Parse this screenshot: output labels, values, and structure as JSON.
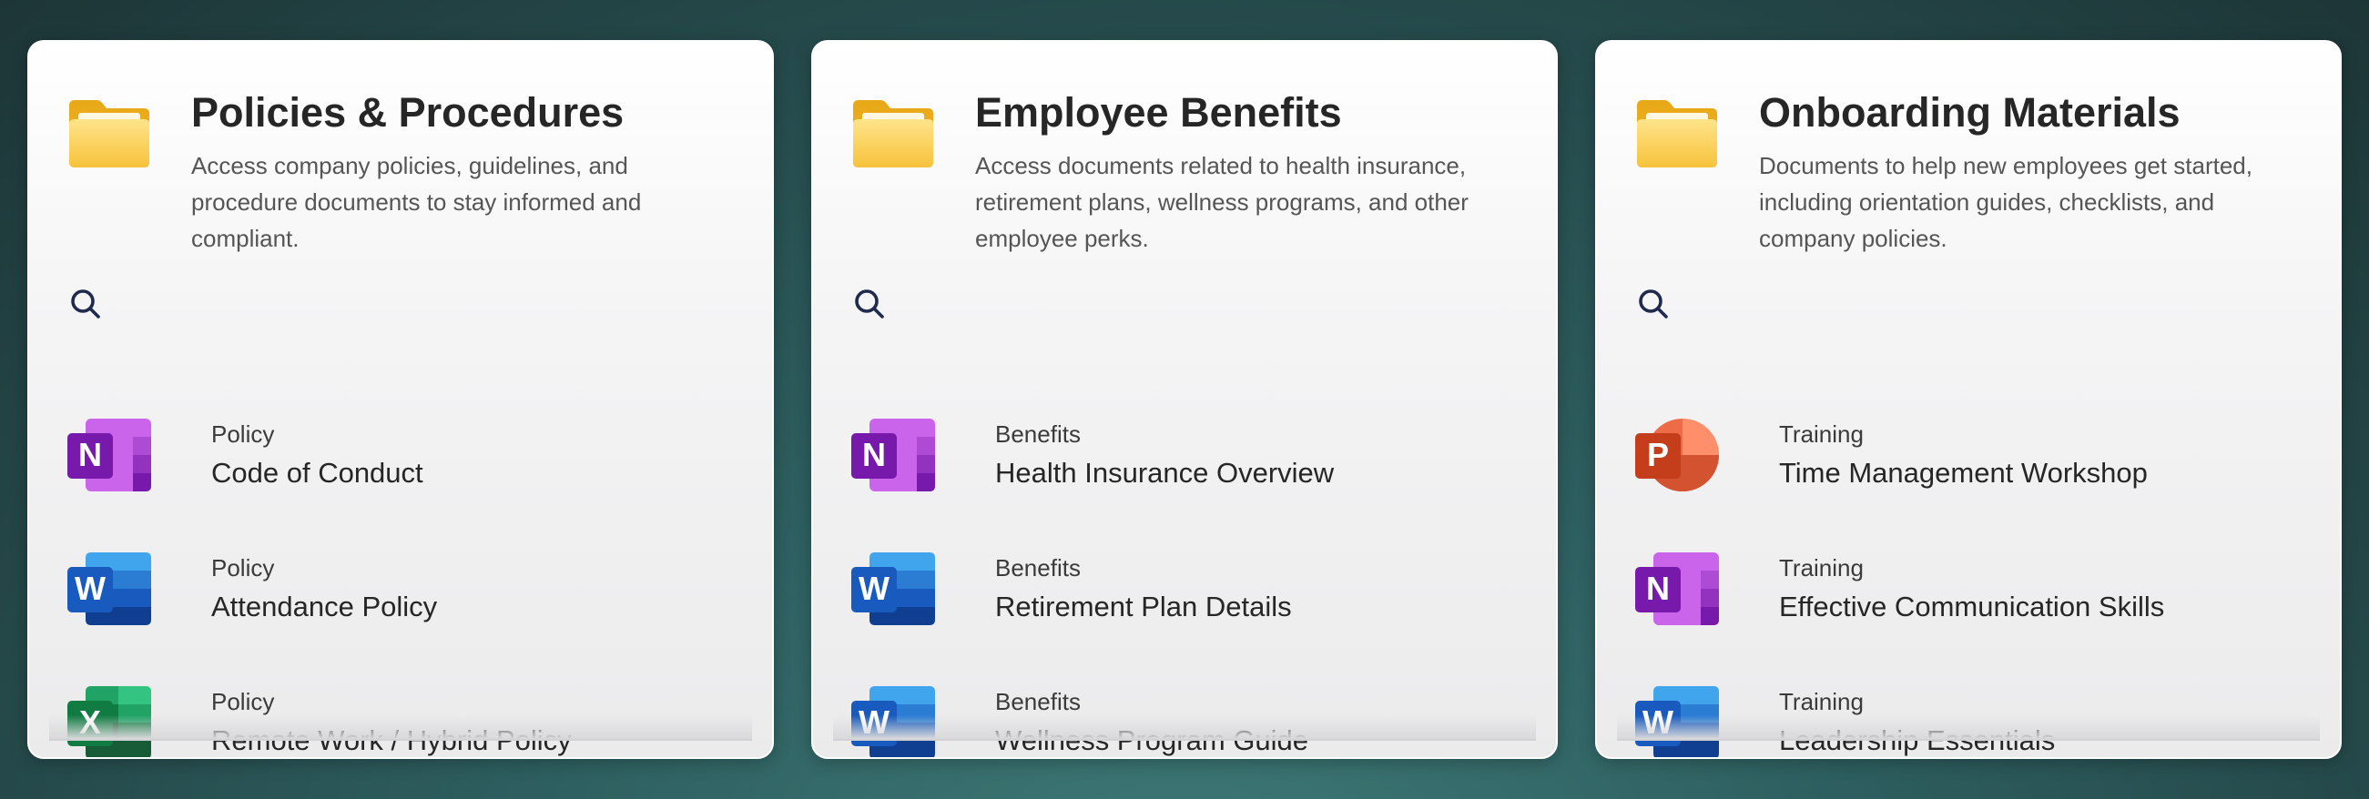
{
  "cards": [
    {
      "title": "Policies & Procedures",
      "description": "Access company policies, guidelines, and procedure documents to stay informed and compliant.",
      "icon": "folder-icon",
      "items": [
        {
          "category": "Policy",
          "name": "Code of Conduct",
          "app": "onenote"
        },
        {
          "category": "Policy",
          "name": "Attendance Policy",
          "app": "word"
        },
        {
          "category": "Policy",
          "name": "Remote Work / Hybrid Policy",
          "app": "excel"
        }
      ]
    },
    {
      "title": "Employee Benefits",
      "description": "Access documents related to health insurance, retirement plans, wellness programs, and other employee perks.",
      "icon": "folder-icon",
      "items": [
        {
          "category": "Benefits",
          "name": "Health Insurance Overview",
          "app": "onenote"
        },
        {
          "category": "Benefits",
          "name": "Retirement Plan Details",
          "app": "word"
        },
        {
          "category": "Benefits",
          "name": "Wellness Program Guide",
          "app": "word"
        }
      ]
    },
    {
      "title": "Onboarding Materials",
      "description": "Documents to help new employees get started, including orientation guides, checklists, and company policies.",
      "icon": "folder-icon",
      "items": [
        {
          "category": "Training",
          "name": "Time Management Workshop",
          "app": "powerpoint"
        },
        {
          "category": "Training",
          "name": "Effective Communication Skills",
          "app": "onenote"
        },
        {
          "category": "Training",
          "name": "Leadership Essentials",
          "app": "word"
        }
      ]
    }
  ],
  "colors": {
    "onenote": "#7719aa",
    "word": "#185abd",
    "excel": "#107c41",
    "powerpoint": "#c43e1c",
    "folder": "#f6c23b",
    "search_icon": "#1f2a4d"
  }
}
